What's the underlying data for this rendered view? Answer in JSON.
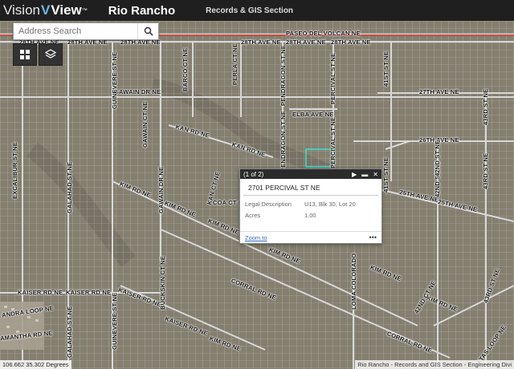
{
  "header": {
    "logo_part1": "Vision",
    "logo_v": "V",
    "logo_part2": "View",
    "logo_tm": "™",
    "city": "Rio Rancho",
    "section": "Records & GIS Section"
  },
  "search": {
    "placeholder": "Address Search",
    "icon": "search-icon"
  },
  "tools": {
    "basemap_icon": "grid-icon",
    "layers_icon": "layers-icon"
  },
  "popup": {
    "count": "(1 of 2)",
    "title": "2701 PERCIVAL ST NE",
    "rows": [
      {
        "label": "Legal Description",
        "value": "U13, Blk 30, Lot 20"
      },
      {
        "label": "Acres",
        "value": "1.00"
      }
    ],
    "zoom_link": "Zoom to",
    "more": "•••"
  },
  "coords": "106.662 35.302 Degrees",
  "attribution": "Rio Rancho - Records and GIS Section - Engineering Divi",
  "labels": {
    "paseo": "PASEO DEL VOLCAN NE",
    "ave28a": "28TH AVE NE",
    "ave28b": "28TH AVE NE",
    "ave28c": "28TH AVE NE",
    "ave28d": "28TH AVE NE",
    "ave28e": "28TH AVE NE",
    "ave28f": "28TH AVE NE",
    "ave27": "27TH AVE NE",
    "ave26": "26TH AVE NE",
    "ave25a": "25TH AVE NE",
    "ave25b": "25TH AVE NE",
    "gawain_dr": "GAWAIN DR NE",
    "elba": "ELBA AVE NE",
    "kan1": "KAN RD NE",
    "kan2": "KAN RD NE",
    "kim1": "KIM RD NE",
    "kim2": "KIM RD NE",
    "kim3": "KIM RD NE",
    "kim4": "KIM RD NE",
    "kim5": "KIM RD NE",
    "kaiser1": "KAISER RD NE",
    "kaiser2": "KAISER RD NE",
    "kaiser3": "KAISER RD NE",
    "kaiser4": "KAISER RD NE",
    "corral1": "CORRAL RD NE",
    "corral2": "CORRAL RD NE",
    "kim_bottom1": "KIM RD NE",
    "kim_bottom2": "KIM RD NE",
    "andra": "ANDRA LOOP NE",
    "amantha": "AMANTHA RD NE",
    "coa": "COA CT NE",
    "guinevere1": "GUINEVERE ST NE",
    "guinevere2": "GUINEVERE ST NE",
    "galahad1": "GALAHAD ST NE",
    "galahad2": "GALAHAD ST NE",
    "excalibur": "EXCALIBUR ST NE",
    "gawain_ct": "GAWAIN CT NE",
    "gawain_dr_v": "GAWAIN DR NE",
    "barco": "BARCO CT NE",
    "perla": "PERLA CT NE",
    "pendragon1": "PENDRAGON ST NE",
    "pendragon2": "PENDRAGON ST NE",
    "percival1": "PERCIVAL ST NE",
    "percival2": "PERCIVAL ST NE",
    "st41a": "41ST ST NE",
    "st41b": "41ST ST NE",
    "st42a": "42ND ST NE",
    "st42b": "42ND ST NE",
    "st43a": "43RD ST NE",
    "st43b": "43RD ST NE",
    "buckskin": "BUCKSKIN CT NE",
    "loma": "LOMA COLORADO",
    "st42c": "42ND CT NE",
    "st43c": "43RD ST NE",
    "matas": "MATAS LOOP NE",
    "kan_ct": "KAN CT NE"
  },
  "colors": {
    "paseo_line": "#d4352c",
    "selected_parcel": "#3fe0d0",
    "header_bg": "#1f1f1f"
  }
}
